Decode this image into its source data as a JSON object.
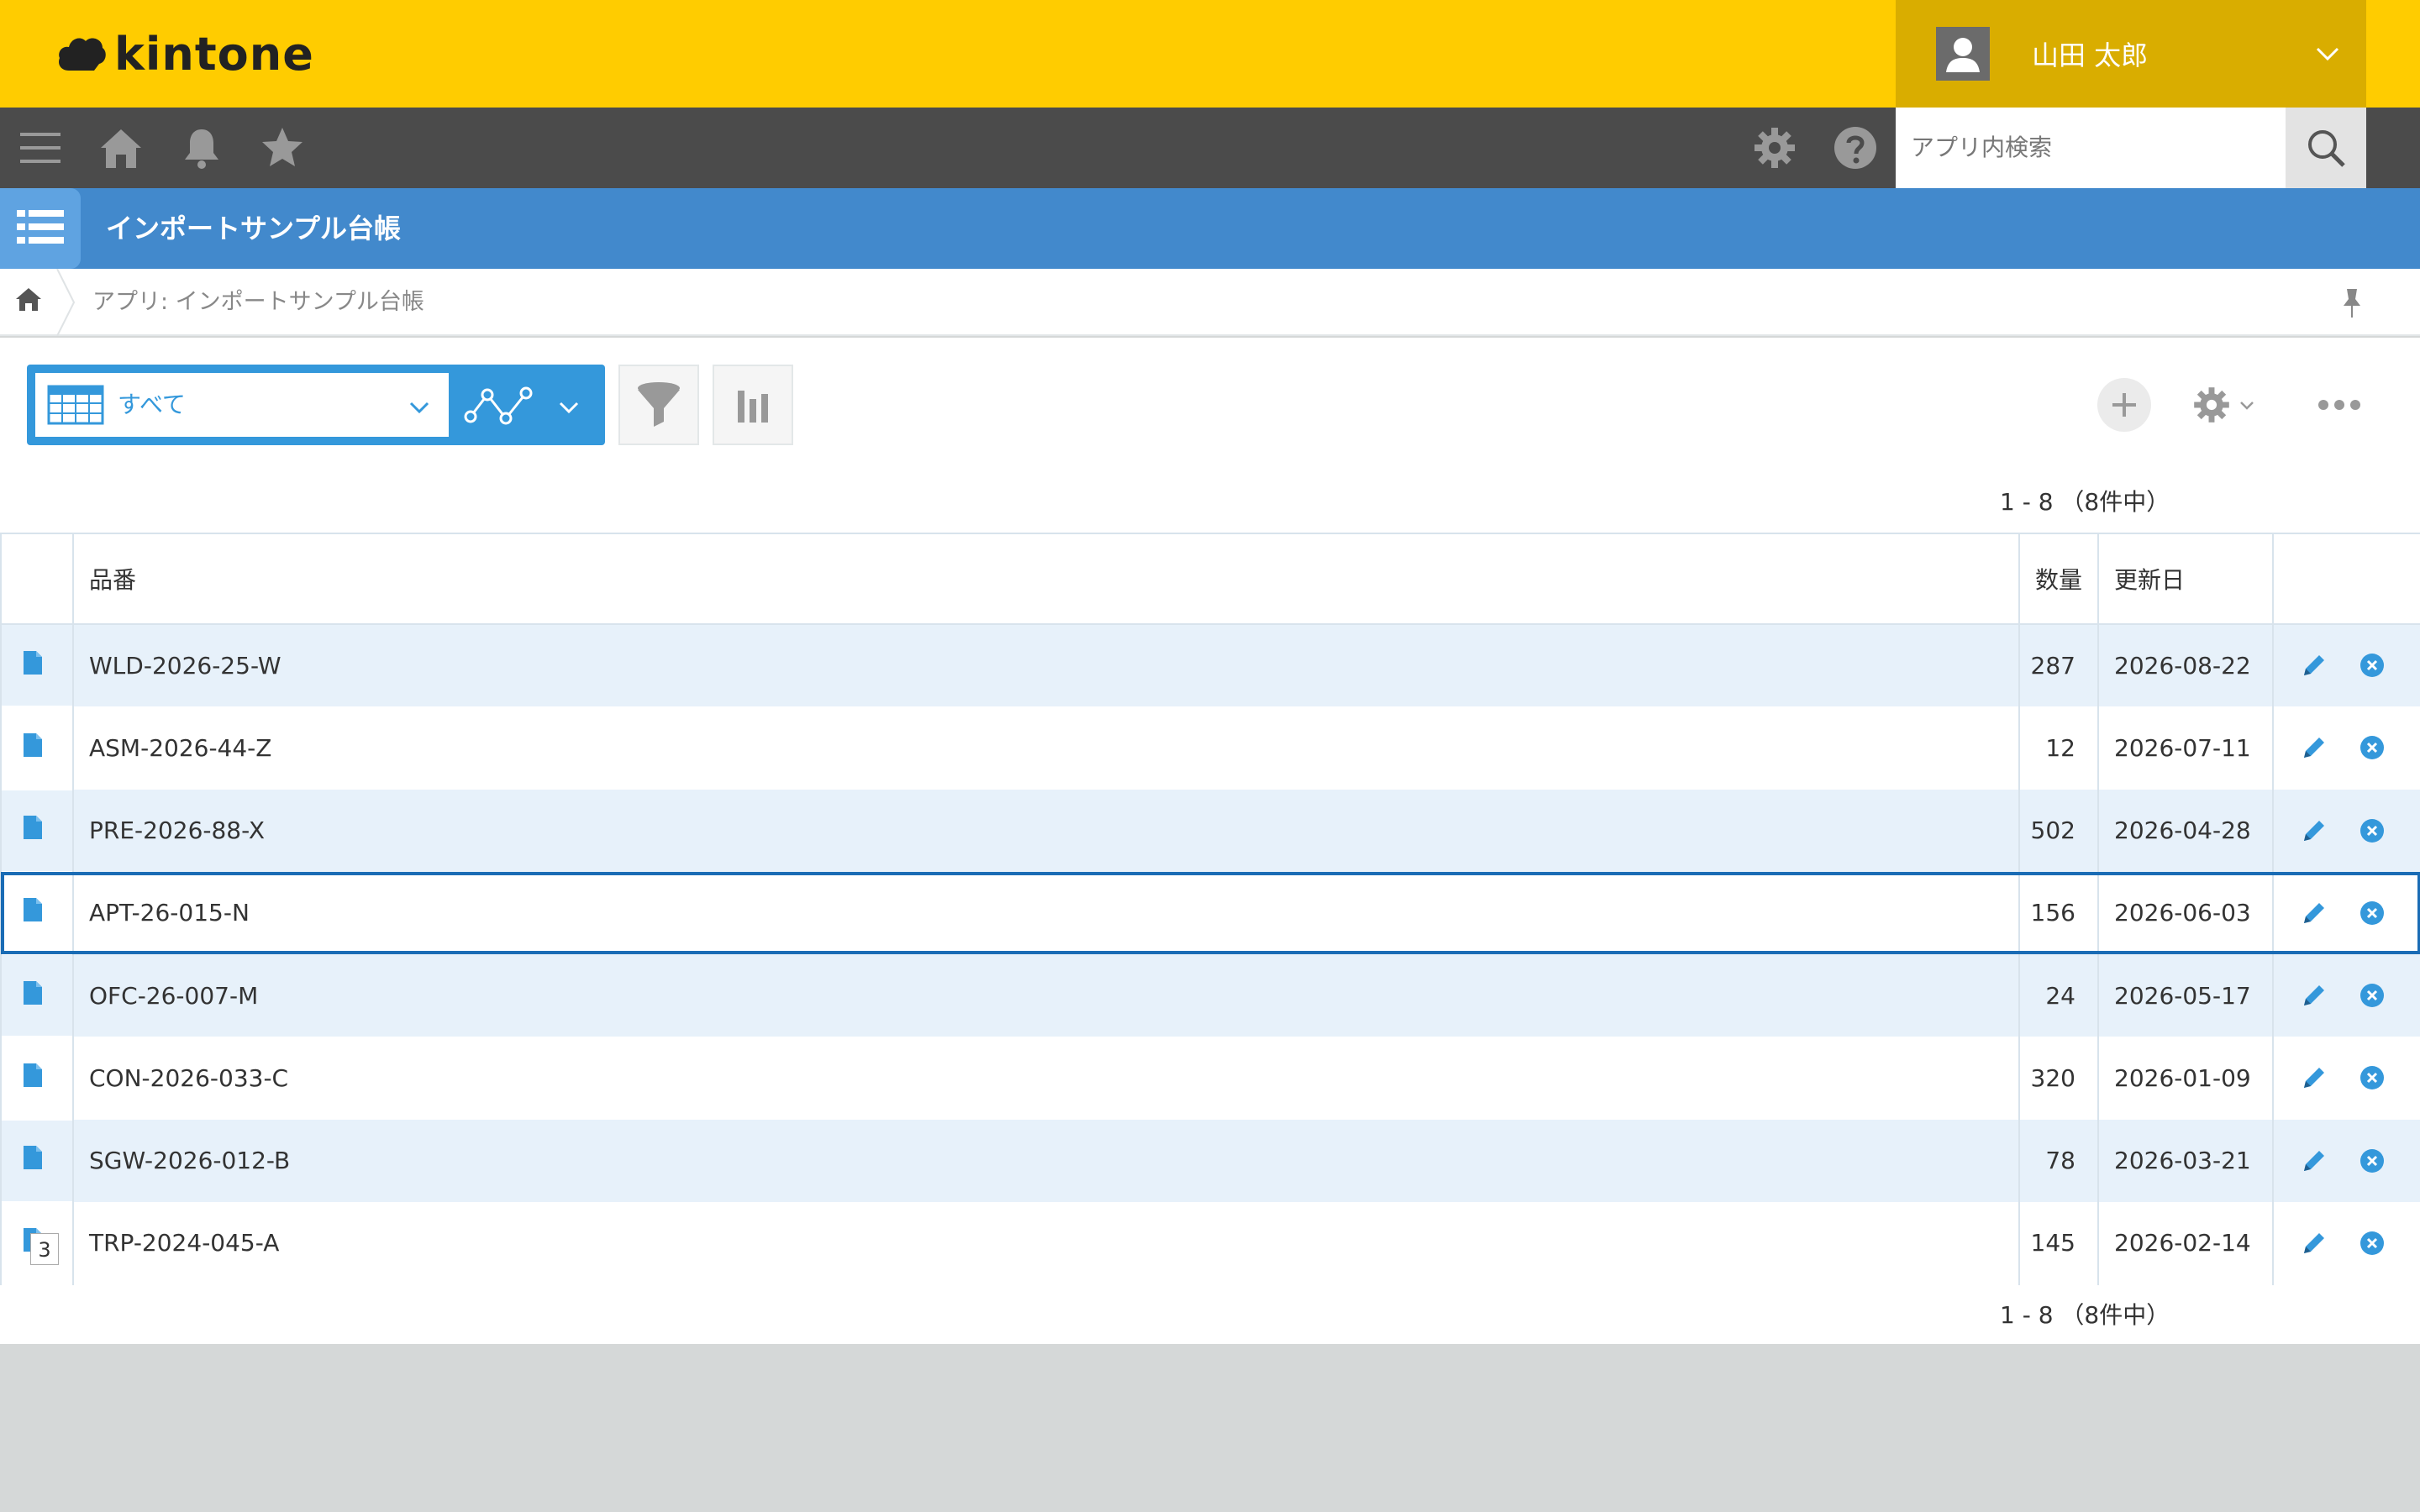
{
  "header": {
    "logo_text": "kintone",
    "user_name": "山田 太郎"
  },
  "gnav": {
    "search_placeholder": "アプリ内検索",
    "icons": [
      "menu-icon",
      "home-icon",
      "bell-icon",
      "star-icon",
      "gear-icon",
      "help-icon",
      "search-icon"
    ]
  },
  "app": {
    "title": "インポートサンプル台帳",
    "breadcrumb": "アプリ: インポートサンプル台帳"
  },
  "toolbar": {
    "view_label": "すべて"
  },
  "pager": {
    "top": "1 - 8 （8件中）",
    "bottom": "1 - 8 （8件中）"
  },
  "table": {
    "columns": [
      "品番",
      "数量",
      "更新日"
    ],
    "rows": [
      {
        "part": "WLD-2026-25-W",
        "qty": "287",
        "date": "2026-08-22"
      },
      {
        "part": "ASM-2026-44-Z",
        "qty": "12",
        "date": "2026-07-11"
      },
      {
        "part": "PRE-2026-88-X",
        "qty": "502",
        "date": "2026-04-28"
      },
      {
        "part": "APT-26-015-N",
        "qty": "156",
        "date": "2026-06-03"
      },
      {
        "part": "OFC-26-007-M",
        "qty": "24",
        "date": "2026-05-17"
      },
      {
        "part": "CON-2026-033-C",
        "qty": "320",
        "date": "2026-01-09"
      },
      {
        "part": "SGW-2026-012-B",
        "qty": "78",
        "date": "2026-03-21"
      },
      {
        "part": "TRP-2024-045-A",
        "qty": "145",
        "date": "2026-02-14",
        "badge": "3"
      }
    ]
  },
  "colors": {
    "header_yellow": "#ffcc00",
    "app_blue": "#4289cc",
    "accent_blue": "#3498db",
    "row_alt": "#e7f1fa"
  }
}
